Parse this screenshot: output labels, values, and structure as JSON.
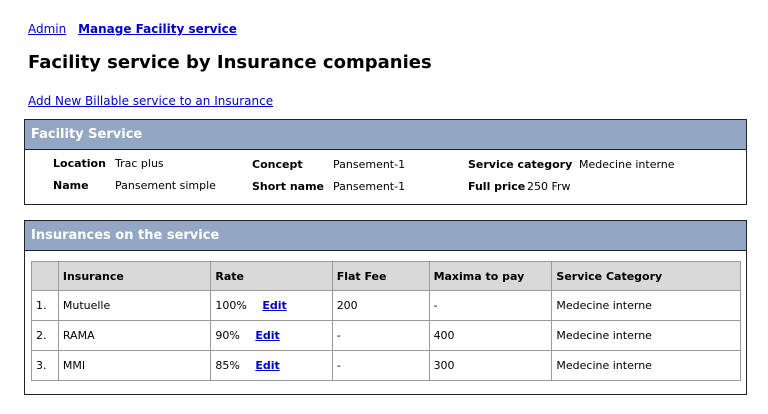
{
  "breadcrumb": {
    "admin": "Admin",
    "current": "Manage Facility service"
  },
  "page_title": "Facility service by Insurance companies",
  "add_link": "Add New Billable service to an Insurance",
  "facility_panel": {
    "header": "Facility Service",
    "location_label": "Location",
    "location_value": "Trac plus",
    "name_label": "Name",
    "name_value": "Pansement simple",
    "concept_label": "Concept",
    "concept_value": "Pansement-1",
    "short_name_label": "Short name",
    "short_name_value": "Pansement-1",
    "service_category_label": "Service category",
    "service_category_value": "Medecine interne",
    "full_price_label": "Full price",
    "full_price_value": "250 Frw"
  },
  "insurances_panel": {
    "header": "Insurances on the service",
    "columns": [
      "Insurance",
      "Rate",
      "Flat Fee",
      "Maxima to pay",
      "Service Category"
    ],
    "edit_label": "Edit",
    "rows": [
      {
        "num": "1.",
        "insurance": "Mutuelle",
        "rate": "100%",
        "flat_fee": "200",
        "maxima": "-",
        "category": "Medecine interne"
      },
      {
        "num": "2.",
        "insurance": "RAMA",
        "rate": "90%",
        "flat_fee": "-",
        "maxima": "400",
        "category": "Medecine interne"
      },
      {
        "num": "3.",
        "insurance": "MMI",
        "rate": "85%",
        "flat_fee": "-",
        "maxima": "300",
        "category": "Medecine interne"
      }
    ]
  }
}
